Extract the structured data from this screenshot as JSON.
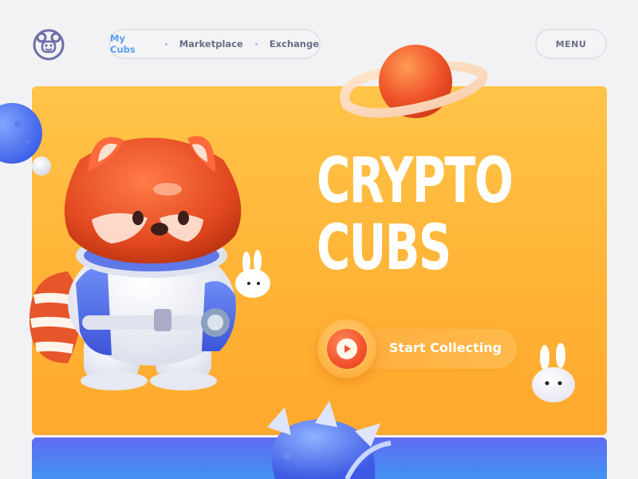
{
  "nav": {
    "items": [
      {
        "label": "My Cubs",
        "active": true
      },
      {
        "label": "Marketplace",
        "active": false
      },
      {
        "label": "Exchange",
        "active": false
      }
    ],
    "menu_label": "MENU"
  },
  "hero": {
    "title_line1": "CRYPTO",
    "title_line2": "CUBS",
    "cta_label": "Start Collecting"
  },
  "colors": {
    "background": "#f2f2f4",
    "hero_orange": "#ffb436",
    "accent_blue": "#5aa0ef",
    "nav_text": "#6b6e87",
    "cta_red": "#f2522e",
    "bottom_panel": "#4f7ff1"
  },
  "icons": {
    "logo": "cub-face-logo-icon",
    "play": "play-icon"
  }
}
